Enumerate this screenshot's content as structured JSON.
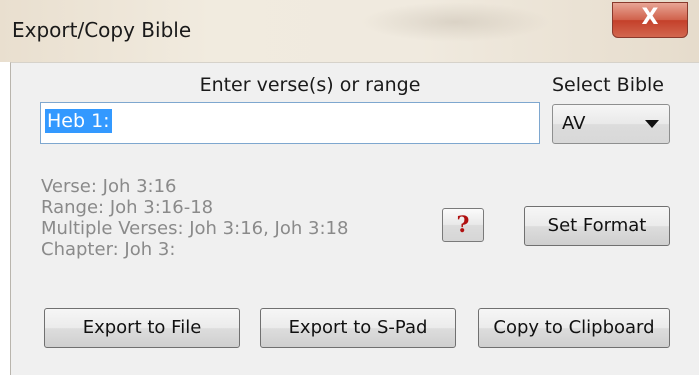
{
  "window": {
    "title": "Export/Copy Bible",
    "close_glyph": "X"
  },
  "form": {
    "prompt_label": "Enter verse(s) or range",
    "verse_input_value": "Heb 1:",
    "select_label": "Select Bible",
    "selected_bible": "AV"
  },
  "examples": [
    "Verse: Joh 3:16",
    "Range: Joh 3:16-18",
    "Multiple Verses: Joh 3:16, Joh 3:18",
    "Chapter: Joh 3:"
  ],
  "buttons": {
    "help_label": "?",
    "set_format": "Set Format",
    "export_file": "Export to File",
    "export_spad": "Export to S-Pad",
    "copy_clipboard": "Copy to Clipboard"
  },
  "icons": {
    "close": "close-icon",
    "dropdown": "chevron-down-icon",
    "help": "help-icon"
  }
}
